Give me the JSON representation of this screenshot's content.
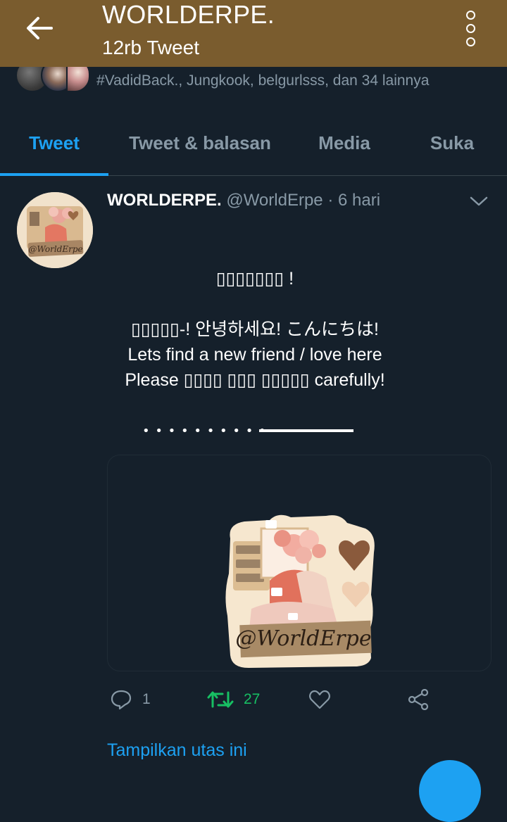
{
  "header": {
    "title": "WORLDERPE.",
    "subtitle": "12rb Tweet",
    "background_color": "#7a5c2e",
    "back_icon": "arrow-left-icon",
    "more_icon": "more-vertical-icon"
  },
  "followers_strip": {
    "text": "#VadidBack., Jungkook, belgurlsss, dan 34 lainnya"
  },
  "tabs": [
    {
      "label": "Tweet",
      "active": true
    },
    {
      "label": "Tweet & balasan",
      "active": false
    },
    {
      "label": "Media",
      "active": false
    },
    {
      "label": "Suka",
      "active": false
    }
  ],
  "tweet": {
    "author_name": "WORLDERPE.",
    "handle": "@WorldErpe",
    "separator": "·",
    "time": "6 hari",
    "body_lines": [
      "▯▯▯▯▯▯▯ !",
      "",
      "▯▯▯▯▯-! 안녕하세요! こんにちは!",
      "Lets find a new friend / love here",
      "Please ▯▯▯▯ ▯▯▯ ▯▯▯▯▯ carefully!"
    ],
    "divider_text": "• • • • • • • • • •",
    "media_watermark": "@WorldErpe",
    "actions": {
      "reply_count": "1",
      "retweet_count": "27",
      "like_count": "",
      "icons": [
        "reply-icon",
        "retweet-icon",
        "like-icon",
        "share-icon"
      ]
    },
    "show_thread_label": "Tampilkan utas ini"
  },
  "colors": {
    "background": "#15202b",
    "accent": "#1da1f2",
    "muted": "#8899a6",
    "retweet_green": "#17bf63"
  }
}
